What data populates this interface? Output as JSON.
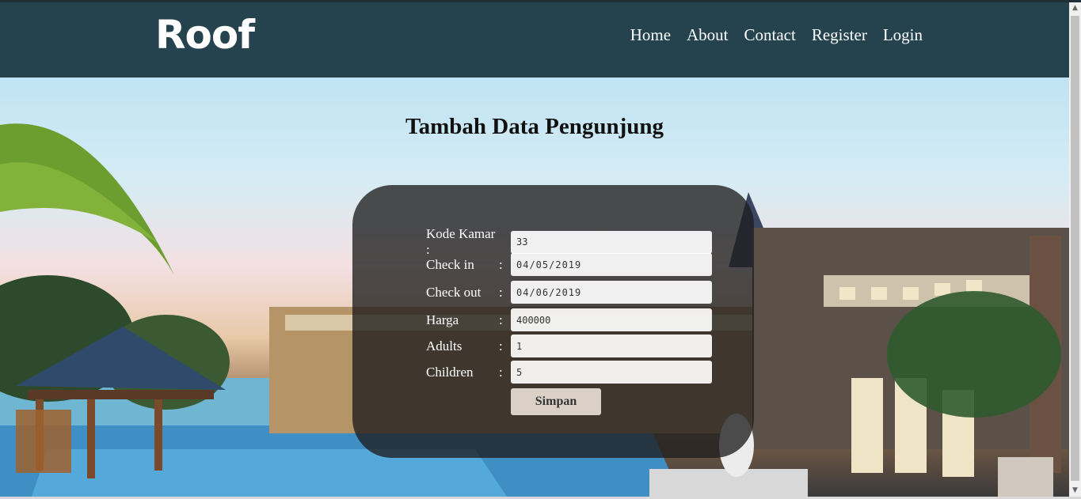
{
  "header": {
    "brand": "Roof",
    "nav": [
      "Home",
      "About",
      "Contact",
      "Register",
      "Login"
    ]
  },
  "main": {
    "title": "Tambah Data Pengunjung",
    "form": {
      "fields": [
        {
          "label": "Kode Kamar :",
          "colon": "",
          "value": "33"
        },
        {
          "label": "Check in",
          "colon": ":",
          "value": "04/05/2019"
        },
        {
          "label": "Check out",
          "colon": ":",
          "value": "04/06/2019"
        },
        {
          "label": "Harga",
          "colon": ":",
          "value": "400000"
        },
        {
          "label": "Adults",
          "colon": ":",
          "value": "1"
        },
        {
          "label": "Children",
          "colon": ":",
          "value": "5"
        }
      ],
      "submit_label": "Simpan"
    }
  },
  "colors": {
    "navbar": "#25434e",
    "panel": "rgba(30,30,30,0.78)"
  },
  "icons": {
    "scroll_up": "scroll-up-arrow-icon",
    "scroll_down": "scroll-down-arrow-icon"
  }
}
